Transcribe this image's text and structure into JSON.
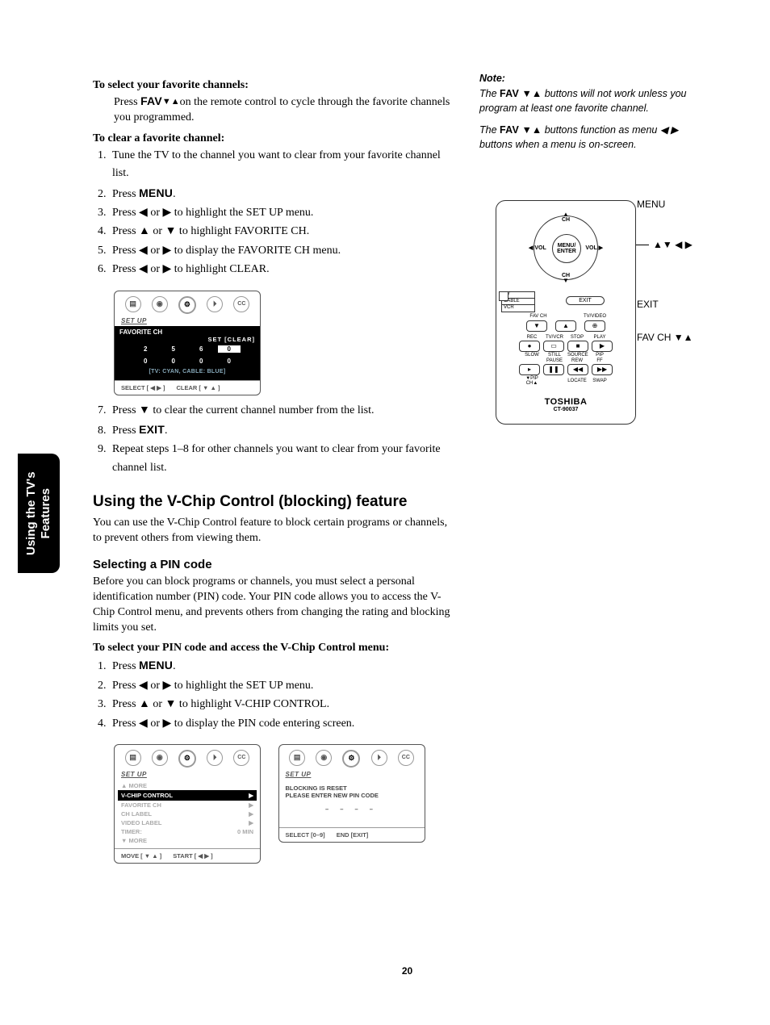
{
  "sideTab": "Using the TV's\nFeatures",
  "pageNumber": "20",
  "section1": {
    "h1": "To select your favorite channels:",
    "p1_a": "Press ",
    "p1_btn": "FAV",
    "p1_arrows": " ▼▲ ",
    "p1_b": "on the remote control to cycle through the favorite channels you programmed."
  },
  "section2": {
    "h": "To clear a favorite channel:",
    "li1": "Tune the TV to the channel you want to clear from your favorite channel list.",
    "li2a": "Press ",
    "li2btn": "MENU",
    "li2b": ".",
    "li3": "Press ◀ or ▶ to highlight the SET UP menu.",
    "li4": "Press ▲ or ▼ to highlight FAVORITE CH.",
    "li5": "Press ◀ or ▶ to display the FAVORITE CH menu.",
    "li6": "Press ◀ or ▶ to highlight CLEAR.",
    "li7": "Press ▼ to clear the current channel number from the list.",
    "li8a": "Press ",
    "li8btn": "EXIT",
    "li8b": ".",
    "li9": "Repeat steps 1–8 for other channels you want to clear from your favorite channel list."
  },
  "osdFav": {
    "section": "SET UP",
    "title": "FAVORITE CH",
    "tabs": "SET  [CLEAR]",
    "cells": [
      "2",
      "5",
      "6",
      "0",
      "0",
      "0",
      "0",
      "0"
    ],
    "hlIndex": 3,
    "legend": "[TV: CYAN,  CABLE: BLUE]",
    "foot1": "SELECT [ ◀  ▶ ]",
    "foot2": "CLEAR [ ▼ ▲ ]"
  },
  "vchip": {
    "head": "Using the V-Chip Control (blocking) feature",
    "intro": "You can use the V-Chip Control feature to block certain programs or channels, to prevent others from viewing them.",
    "sub": "Selecting a PIN code",
    "p": "Before you can block programs or channels, you must select a personal identification number (PIN) code. Your PIN code allows you to access the V-Chip Control menu, and prevents others from changing the rating and blocking limits you set.",
    "h3": "To select your PIN code and access the V-Chip Control menu:",
    "li1a": "Press ",
    "li1btn": "MENU",
    "li1b": ".",
    "li2": "Press ◀ or ▶ to highlight the SET UP menu.",
    "li3": "Press ▲ or ▼ to highlight V-CHIP CONTROL.",
    "li4": "Press ◀ or ▶ to display the PIN code entering screen."
  },
  "osdVchip": {
    "section": "SET UP",
    "more1": "▲ MORE",
    "items": [
      {
        "l": "V-CHIP CONTROL",
        "r": "▶",
        "sel": true
      },
      {
        "l": "FAVORITE CH",
        "r": "▶"
      },
      {
        "l": "CH LABEL",
        "r": "▶"
      },
      {
        "l": "VIDEO LABEL",
        "r": "▶"
      },
      {
        "l": "TIMER:",
        "r": "0 MIN"
      }
    ],
    "more2": "▼ MORE",
    "foot1": "MOVE [ ▼ ▲ ]",
    "foot2": "START [ ◀  ▶ ]"
  },
  "osdPin": {
    "section": "SET UP",
    "l1": "BLOCKING IS RESET",
    "l2": "PLEASE ENTER NEW PIN CODE",
    "dashes": "– – – –",
    "foot1": "SELECT [0–9]",
    "foot2": "END [EXIT]"
  },
  "note": {
    "title": "Note:",
    "p1a": "The ",
    "p1btn": "FAV",
    "p1arr": " ▼▲ ",
    "p1b": "buttons will not work unless you program at least one favorite channel.",
    "p2a": "The ",
    "p2btn": "FAV",
    "p2arr": " ▼▲ ",
    "p2b": "buttons function as menu ◀ ▶ buttons when a menu is on-screen."
  },
  "remote": {
    "menuEnter": "MENU/\nENTER",
    "ch": "CH",
    "vol": "VOL",
    "sw": [
      "TV",
      "CABLE",
      "VCR"
    ],
    "exit": "EXIT",
    "favch": "FAV CH",
    "tvvideo": "TV/VIDEO",
    "rec": "REC",
    "tvvcr": "TV/VCR",
    "stop": "STOP",
    "play": "PLAY",
    "slow": "SLOW",
    "pause": "PAUSE",
    "rew": "REW",
    "ff": "FF",
    "still": "STILL",
    "source": "SOURCE",
    "pip": "PIP",
    "pipch": "▼PIP CH▲",
    "locate": "LOCATE",
    "swap": "SWAP",
    "brand": "TOSHIBA",
    "model": "CT-90037"
  },
  "callouts": {
    "menu": "MENU",
    "arrows": "▲▼ ◀ ▶",
    "exit": "EXIT",
    "favch": "FAV CH ▼▲"
  }
}
